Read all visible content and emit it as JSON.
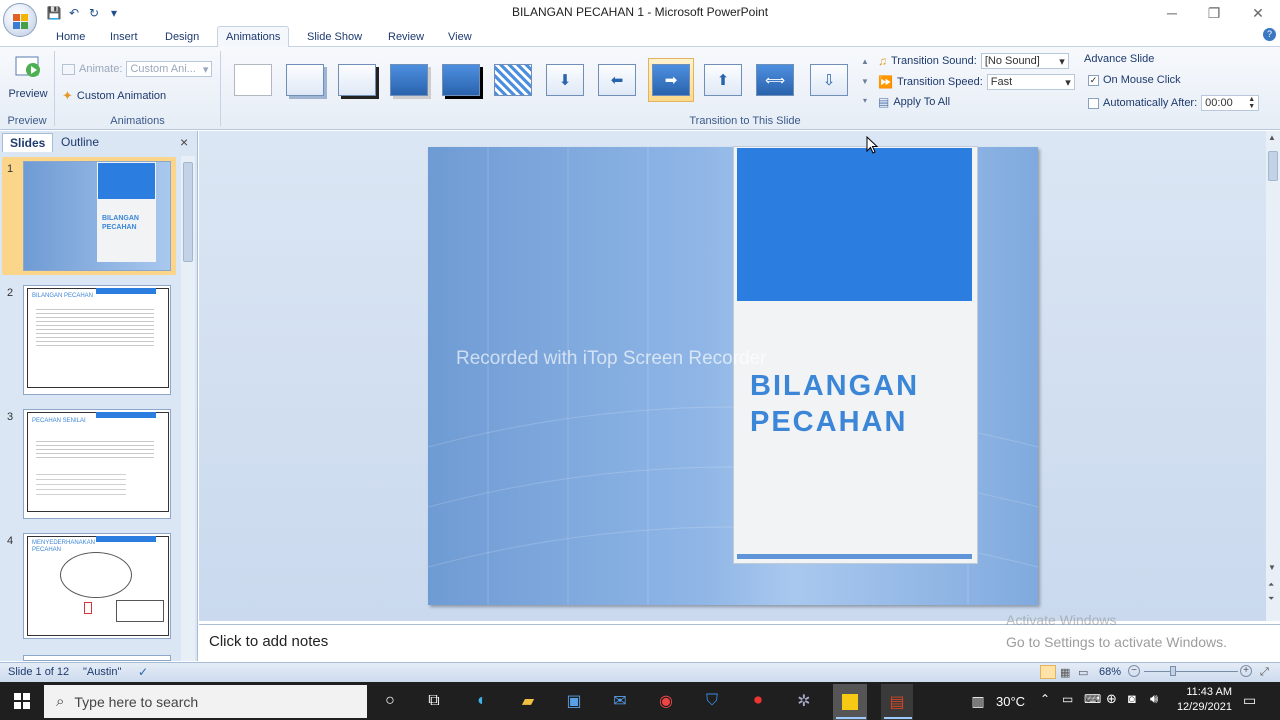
{
  "window": {
    "title": "BILANGAN PECAHAN 1 - Microsoft PowerPoint",
    "minimize": "─",
    "restore": "❐",
    "close": "✕"
  },
  "qat": {
    "save": "💾",
    "undo": "↶",
    "redo": "↻",
    "more": "▾"
  },
  "tabs": [
    "Home",
    "Insert",
    "Design",
    "Animations",
    "Slide Show",
    "Review",
    "View"
  ],
  "ribbon": {
    "preview_label": "Preview",
    "preview_group": "Preview",
    "animate_label": "Animate:",
    "animate_value": "Custom Ani...",
    "custom_animation": "Custom Animation",
    "animations_group": "Animations",
    "transition_group": "Transition to This Slide",
    "transition_sound_label": "Transition Sound:",
    "transition_sound_value": "[No Sound]",
    "transition_speed_label": "Transition Speed:",
    "transition_speed_value": "Fast",
    "apply_to_all": "Apply To All",
    "advance_slide": "Advance Slide",
    "on_mouse_click": "On Mouse Click",
    "on_mouse_click_checked": "✓",
    "automatically_after": "Automatically After:",
    "auto_time": "00:00"
  },
  "pane": {
    "tab_slides": "Slides",
    "tab_outline": "Outline",
    "close": "×",
    "slides": [
      {
        "num": "1",
        "title": "BILANGAN PECAHAN"
      },
      {
        "num": "2",
        "title": "BILANGAN PECAHAN"
      },
      {
        "num": "3",
        "title": "PECAHAN SENILAI"
      },
      {
        "num": "4",
        "title": "MENYEDERHANAKAN PECAHAN"
      }
    ]
  },
  "slide": {
    "title_line1": "BILANGAN",
    "title_line2": "PECAHAN",
    "watermark": "Recorded with iTop Screen Recorder"
  },
  "notes": {
    "placeholder": "Click to add notes",
    "activate_title": "Activate Windows",
    "activate_sub": "Go to Settings to activate Windows."
  },
  "status": {
    "slide_info": "Slide 1 of 12",
    "theme": "\"Austin\"",
    "zoom": "68%"
  },
  "taskbar": {
    "search_placeholder": "Type here to search",
    "temperature": "30°C",
    "time": "11:43 AM",
    "date": "12/29/2021"
  }
}
